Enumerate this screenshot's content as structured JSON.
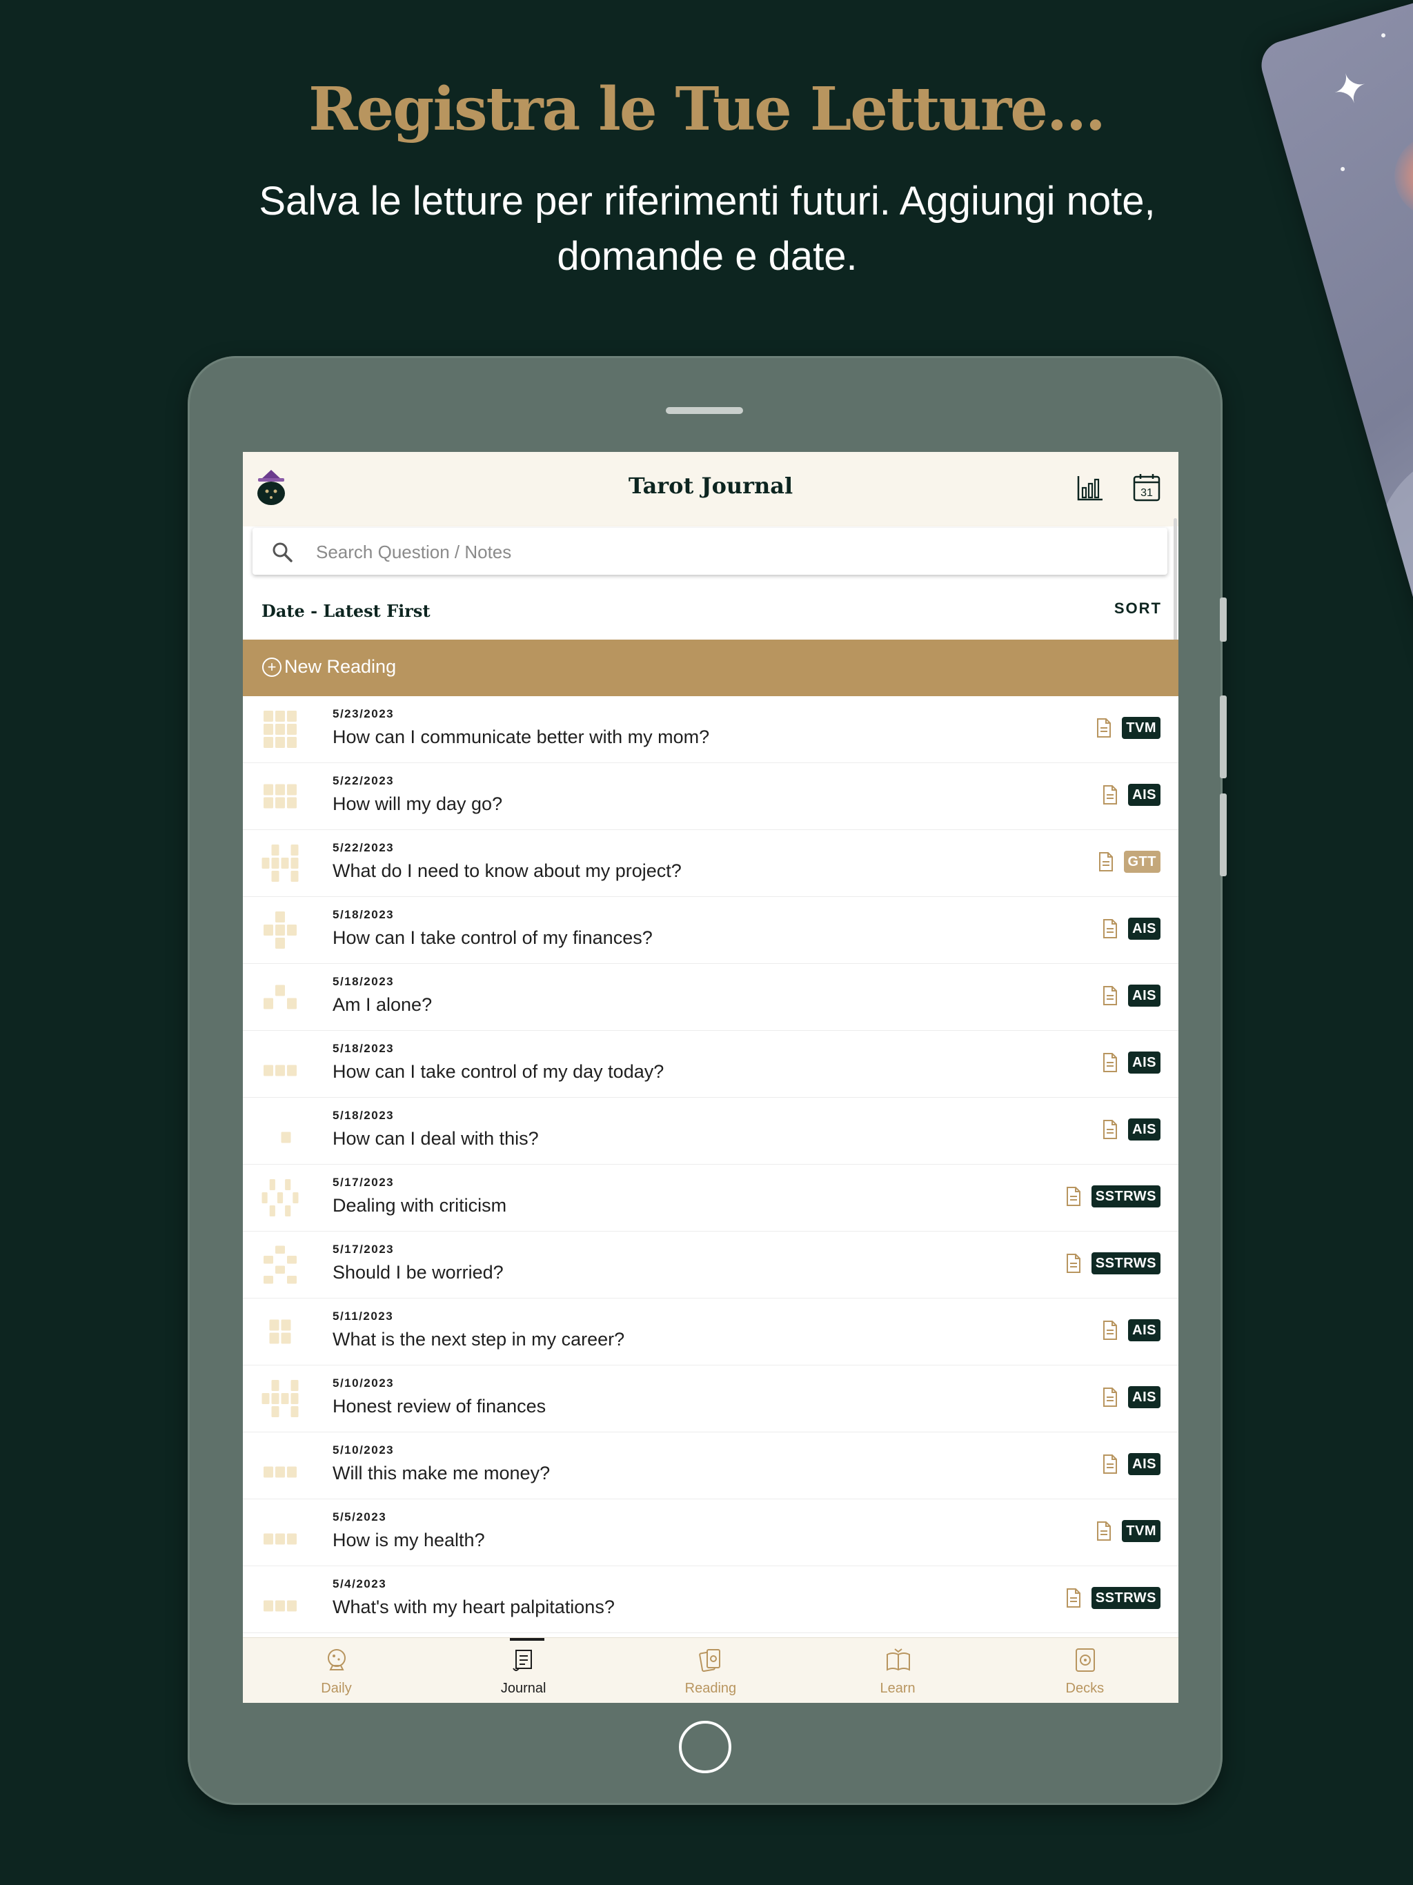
{
  "promo": {
    "headline": "Registra le Tue Letture...",
    "subline": "Salva le letture per riferimenti futuri. Aggiungi note, domande e date."
  },
  "app": {
    "title": "Tarot Journal",
    "stats_icon": "bar-chart-icon",
    "calendar_icon": "calendar-icon",
    "calendar_day": "31"
  },
  "search": {
    "placeholder": "Search Question / Notes",
    "value": ""
  },
  "sort": {
    "label": "Date - Latest First",
    "button": "SORT"
  },
  "new_reading": {
    "label": "New Reading"
  },
  "readings": [
    {
      "date": "5/23/2023",
      "question": "How can I communicate better with my mom?",
      "tag": "TVM",
      "tag_style": "dark",
      "spread": "grid3"
    },
    {
      "date": "5/22/2023",
      "question": "How will my day go?",
      "tag": "AIS",
      "tag_style": "dark",
      "spread": "grid2"
    },
    {
      "date": "5/22/2023",
      "question": "What do I need to know about my project?",
      "tag": "GTT",
      "tag_style": "gold",
      "spread": "celtic"
    },
    {
      "date": "5/18/2023",
      "question": "How can I take control of my finances?",
      "tag": "AIS",
      "tag_style": "dark",
      "spread": "cross"
    },
    {
      "date": "5/18/2023",
      "question": "Am I alone?",
      "tag": "AIS",
      "tag_style": "dark",
      "spread": "pyramid"
    },
    {
      "date": "5/18/2023",
      "question": "How can I take control of my day today?",
      "tag": "AIS",
      "tag_style": "dark",
      "spread": "three"
    },
    {
      "date": "5/18/2023",
      "question": "How can I deal with this?",
      "tag": "AIS",
      "tag_style": "dark",
      "spread": "single"
    },
    {
      "date": "5/17/2023",
      "question": "Dealing with criticism",
      "tag": "SSTRWS",
      "tag_style": "dark",
      "spread": "wave"
    },
    {
      "date": "5/17/2023",
      "question": "Should I be worried?",
      "tag": "SSTRWS",
      "tag_style": "dark",
      "spread": "tree"
    },
    {
      "date": "5/11/2023",
      "question": "What is the next step in my career?",
      "tag": "AIS",
      "tag_style": "dark",
      "spread": "four"
    },
    {
      "date": "5/10/2023",
      "question": "Honest review of finances",
      "tag": "AIS",
      "tag_style": "dark",
      "spread": "celtic"
    },
    {
      "date": "5/10/2023",
      "question": "Will this make me money?",
      "tag": "AIS",
      "tag_style": "dark",
      "spread": "three"
    },
    {
      "date": "5/5/2023",
      "question": "How is my health?",
      "tag": "TVM",
      "tag_style": "dark",
      "spread": "three"
    },
    {
      "date": "5/4/2023",
      "question": "What's with my heart palpitations?",
      "tag": "SSTRWS",
      "tag_style": "dark",
      "spread": "three"
    }
  ],
  "tabs": [
    {
      "label": "Daily",
      "icon": "crystal-ball-icon",
      "active": false
    },
    {
      "label": "Journal",
      "icon": "scroll-icon",
      "active": true
    },
    {
      "label": "Reading",
      "icon": "cards-icon",
      "active": false
    },
    {
      "label": "Learn",
      "icon": "book-icon",
      "active": false
    },
    {
      "label": "Decks",
      "icon": "deck-icon",
      "active": false
    }
  ],
  "colors": {
    "background": "#0d2520",
    "accent_gold": "#b8955f",
    "tag_dark": "#0f2a24",
    "tag_gold": "#c4a77a",
    "spread_card": "#f3e6c7"
  }
}
